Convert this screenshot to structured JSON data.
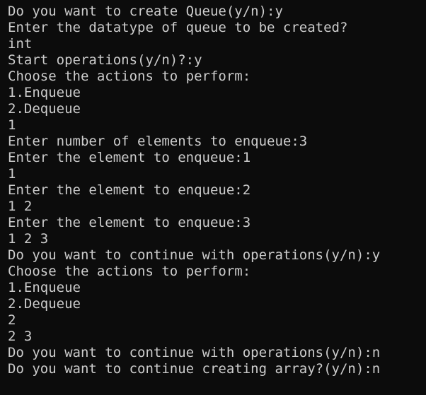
{
  "terminal": {
    "background": "#0c0c0c",
    "foreground": "#cccccc",
    "lines": [
      "Do you want to create Queue(y/n):y",
      "Enter the datatype of queue to be created?",
      "int",
      "Start operations(y/n)?:y",
      "Choose the actions to perform:",
      "1.Enqueue",
      "2.Dequeue",
      "1",
      "Enter number of elements to enqueue:3",
      "Enter the element to enqueue:1",
      "1",
      "Enter the element to enqueue:2",
      "1 2",
      "Enter the element to enqueue:3",
      "1 2 3",
      "Do you want to continue with operations(y/n):y",
      "Choose the actions to perform:",
      "1.Enqueue",
      "2.Dequeue",
      "2",
      "2 3",
      "Do you want to continue with operations(y/n):n",
      "Do you want to continue creating array?(y/n):n"
    ]
  }
}
